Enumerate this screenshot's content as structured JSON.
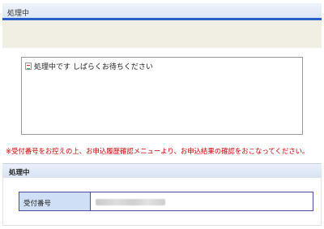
{
  "header": {
    "title": "処理中"
  },
  "message_box": {
    "text": "処理中です しばらくお待ちください",
    "icon": "broken-image-icon"
  },
  "notice": {
    "text": "※受付番号をお控えの上、お申込履歴確認メニューより、お申込結果の確認をおこなってください。",
    "color": "#cc0000"
  },
  "section": {
    "title": "処理中",
    "field_label": "受付番号"
  },
  "colors": {
    "accent": "#2a5fc9",
    "label_bg": "#cfe0f6",
    "border": "#4b4aa7",
    "band": "#f1eee3"
  }
}
